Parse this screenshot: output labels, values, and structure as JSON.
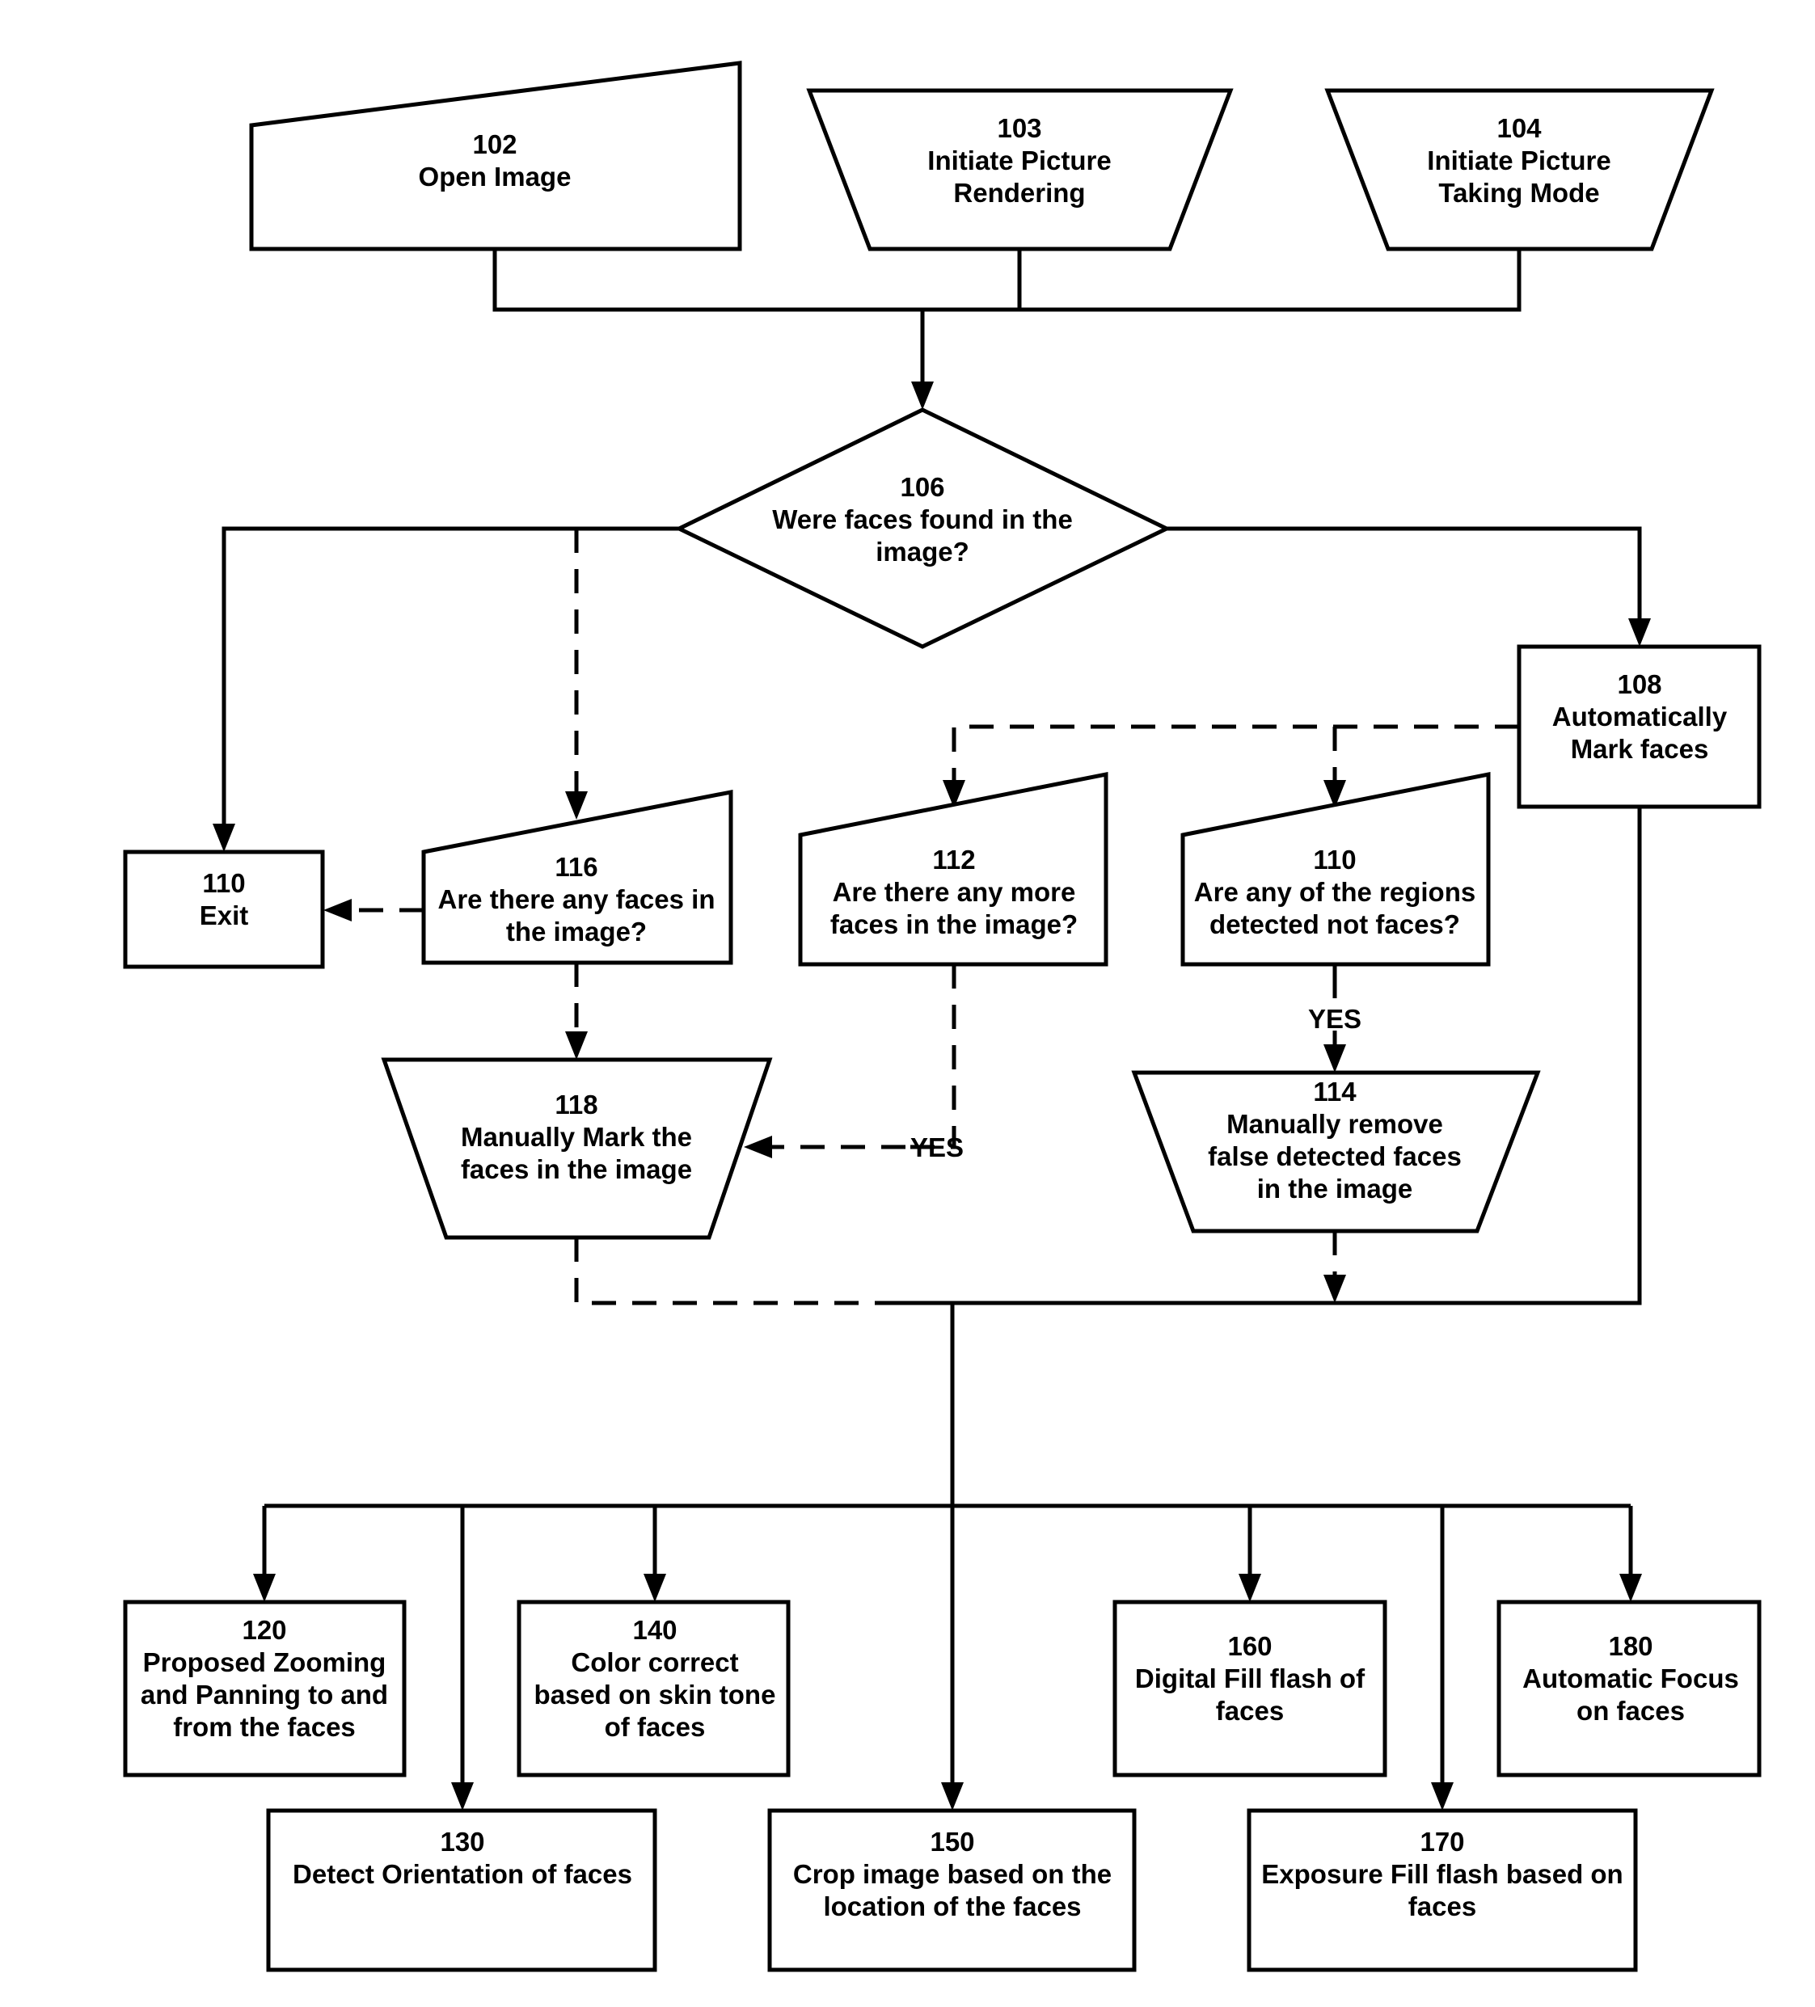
{
  "diagram": {
    "type": "flowchart",
    "nodes": {
      "n102": {
        "id": "102",
        "lines": [
          "Open Image"
        ],
        "shape": "manual-input"
      },
      "n103": {
        "id": "103",
        "lines": [
          "Initiate Picture",
          "Rendering"
        ],
        "shape": "manual-operation"
      },
      "n104": {
        "id": "104",
        "lines": [
          "Initiate Picture",
          "Taking Mode"
        ],
        "shape": "manual-operation"
      },
      "n106": {
        "id": "106",
        "lines": [
          "Were faces found in the",
          "image?"
        ],
        "shape": "decision"
      },
      "n108": {
        "id": "108",
        "lines": [
          "Automatically",
          "Mark faces"
        ],
        "shape": "process"
      },
      "n110exit": {
        "id": "110",
        "lines": [
          "Exit"
        ],
        "shape": "process"
      },
      "n116": {
        "id": "116",
        "lines": [
          "Are there any faces in",
          "the image?"
        ],
        "shape": "manual-input"
      },
      "n112": {
        "id": "112",
        "lines": [
          "Are there any more",
          "faces in the image?"
        ],
        "shape": "manual-input"
      },
      "n110q": {
        "id": "110",
        "lines": [
          "Are any of the regions",
          "detected not faces?"
        ],
        "shape": "manual-input"
      },
      "n118": {
        "id": "118",
        "lines": [
          "Manually Mark the",
          "faces in the image"
        ],
        "shape": "manual-operation"
      },
      "n114": {
        "id": "114",
        "lines": [
          "Manually remove",
          "false detected faces",
          "in the image"
        ],
        "shape": "manual-operation"
      },
      "n120": {
        "id": "120",
        "lines": [
          "Proposed Zooming",
          "and Panning to and",
          "from the faces"
        ],
        "shape": "process"
      },
      "n130": {
        "id": "130",
        "lines": [
          "Detect Orientation of faces"
        ],
        "shape": "process"
      },
      "n140": {
        "id": "140",
        "lines": [
          "Color correct",
          "based on skin tone",
          "of faces"
        ],
        "shape": "process"
      },
      "n150": {
        "id": "150",
        "lines": [
          "Crop image based on the",
          "location of the faces"
        ],
        "shape": "process"
      },
      "n160": {
        "id": "160",
        "lines": [
          "Digital Fill flash of",
          "faces"
        ],
        "shape": "process"
      },
      "n170": {
        "id": "170",
        "lines": [
          "Exposure Fill flash based on",
          "faces"
        ],
        "shape": "process"
      },
      "n180": {
        "id": "180",
        "lines": [
          "Automatic Focus",
          "on faces"
        ],
        "shape": "process"
      }
    },
    "edge_labels": {
      "yes_112_to_118": "YES",
      "yes_110_to_114": "YES"
    },
    "edges": [
      {
        "from": "102",
        "to": "106",
        "style": "solid"
      },
      {
        "from": "103",
        "to": "106",
        "style": "solid"
      },
      {
        "from": "104",
        "to": "106",
        "style": "solid"
      },
      {
        "from": "106",
        "to": "110 Exit",
        "style": "solid"
      },
      {
        "from": "106",
        "to": "116",
        "style": "dashed"
      },
      {
        "from": "106",
        "to": "108",
        "style": "solid"
      },
      {
        "from": "108",
        "to": "112",
        "style": "dashed"
      },
      {
        "from": "108",
        "to": "110",
        "style": "dashed"
      },
      {
        "from": "116",
        "to": "110 Exit",
        "style": "dashed"
      },
      {
        "from": "116",
        "to": "118",
        "style": "dashed"
      },
      {
        "from": "112",
        "to": "118",
        "style": "dashed",
        "label": "YES"
      },
      {
        "from": "110",
        "to": "114",
        "style": "dashed",
        "label": "YES"
      },
      {
        "from": "118",
        "to": "merge",
        "style": "dashed"
      },
      {
        "from": "114",
        "to": "merge",
        "style": "dashed"
      },
      {
        "from": "108",
        "to": "merge",
        "style": "solid"
      },
      {
        "from": "merge",
        "to": [
          "120",
          "130",
          "140",
          "150",
          "160",
          "170",
          "180"
        ],
        "style": "solid"
      }
    ]
  }
}
